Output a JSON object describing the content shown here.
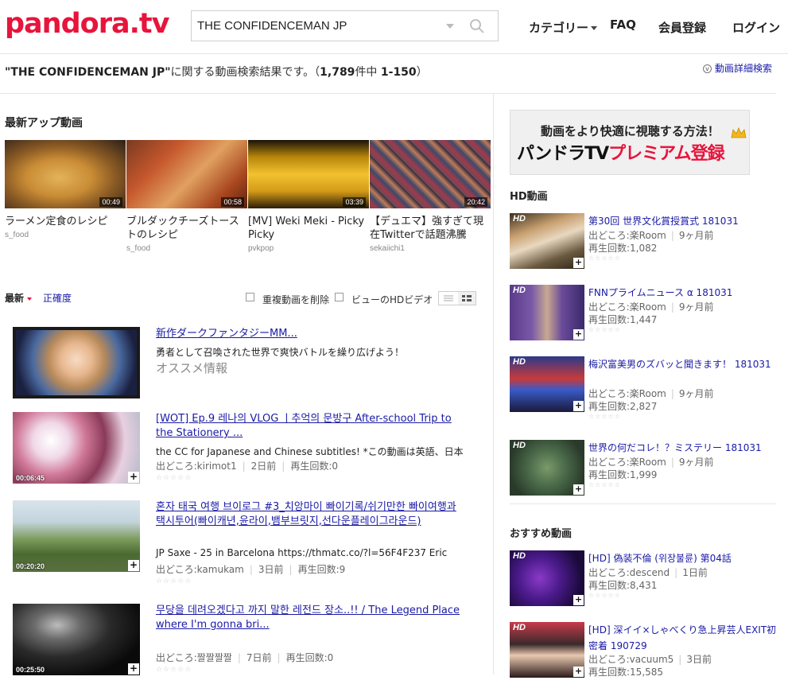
{
  "header": {
    "logo": "pandora.tv",
    "search_value": "THE CONFIDENCEMAN JP",
    "nav": {
      "category": "カテゴリー",
      "faq": "FAQ",
      "register": "会員登録",
      "login": "ログイン"
    }
  },
  "summary": {
    "query": "\"THE CONFIDENCEMAN JP\"",
    "text": "に関する動画検索結果です。（",
    "count": "1,789",
    "mid": "件中 ",
    "range": "1-150",
    "end": "）",
    "detail_link": "動画詳細検索"
  },
  "latest": {
    "title": "最新アップ動画",
    "items": [
      {
        "title": "ラーメン定食のレシピ",
        "channel": "s_food",
        "duration": "00:49"
      },
      {
        "title": "ブルダックチーズトーストのレシピ",
        "channel": "s_food",
        "duration": "00:58"
      },
      {
        "title": "[MV] Weki Meki - Picky Picky",
        "channel": "pvkpop",
        "duration": "03:39"
      },
      {
        "title": "【デュエマ】強すぎて現在Twitterで話題沸騰",
        "channel": "sekaiichi1",
        "duration": "20:42"
      }
    ]
  },
  "sortbar": {
    "latest": "最新",
    "accuracy": "正確度",
    "dedupe": "重複動画を削除",
    "hd": "ビューのHDビデオ"
  },
  "results": [
    {
      "title": "新作ダークファンタジーMM...",
      "desc": "勇者として召喚された世界で爽快バトルを繰り広げよう！",
      "ad": "オススメ情報"
    },
    {
      "title": "[WOT] Ep.9 레나의 VLOG ㅣ추억의 문방구 After-school Trip to the Stationery ...",
      "desc": "the CC for Japanese and Chinese subtitles! *この動画は英語、日本",
      "source": "出どころ:kirimot1",
      "age": "2日前",
      "views": "再生回数:0",
      "duration": "00:06:45"
    },
    {
      "title": "혼자 태국 여행 브이로그 #3_치앙마이 빠이기록/쉬기만한 빠이여행과 택시투어(빠이캐년,윤라이,뱀부브릿지,선다운플레이그라운드)",
      "desc": "JP Saxe - 25 in Barcelona https://thmatc.co/?l=56F4F237 Eric",
      "source": "出どころ:kamukam",
      "age": "3日前",
      "views": "再生回数:9",
      "duration": "00:20:20"
    },
    {
      "title": "무당을 데려오겠다고 까지 말한 레전드 장소..!! / The Legend Place where I'm gonna bri...",
      "desc": "",
      "source": "出どころ:짤짤짤짤",
      "age": "7日前",
      "views": "再生回数:0",
      "duration": "00:25:50"
    }
  ],
  "ad": {
    "line1": "動画をより快適に視聴する方法！",
    "line2a": "パンドラTV",
    "line2b": "プレミアム登録"
  },
  "hd": {
    "title": "HD動画",
    "badge": "HD",
    "items": [
      {
        "title": "第30回 世界文化賞授賞式 181031",
        "source": "出どころ:楽Room",
        "age": "9ヶ月前",
        "views": "再生回数:1,082"
      },
      {
        "title": "FNNプライムニュース α 181031",
        "source": "出どころ:楽Room",
        "age": "9ヶ月前",
        "views": "再生回数:1,447"
      },
      {
        "title": "梅沢富美男のズバッと聞きます！ 181031",
        "source": "出どころ:楽Room",
        "age": "9ヶ月前",
        "views": "再生回数:2,827"
      },
      {
        "title": "世界の何だコレ！？ミステリー 181031",
        "source": "出どころ:楽Room",
        "age": "9ヶ月前",
        "views": "再生回数:1,999"
      }
    ]
  },
  "rec": {
    "title": "おすすめ動画",
    "items": [
      {
        "title": "[HD] 偽装不倫 (위장불륜) 第04話",
        "source": "出どころ:descend",
        "age": "1日前",
        "views": "再生回数:8,431"
      },
      {
        "title": "[HD] 深イイ×しゃべくり急上昇芸人EXIT初密着 190729",
        "source": "出どころ:vacuum5",
        "age": "3日前",
        "views": "再生回数:15,585"
      }
    ]
  },
  "stars": "☆☆☆☆☆"
}
